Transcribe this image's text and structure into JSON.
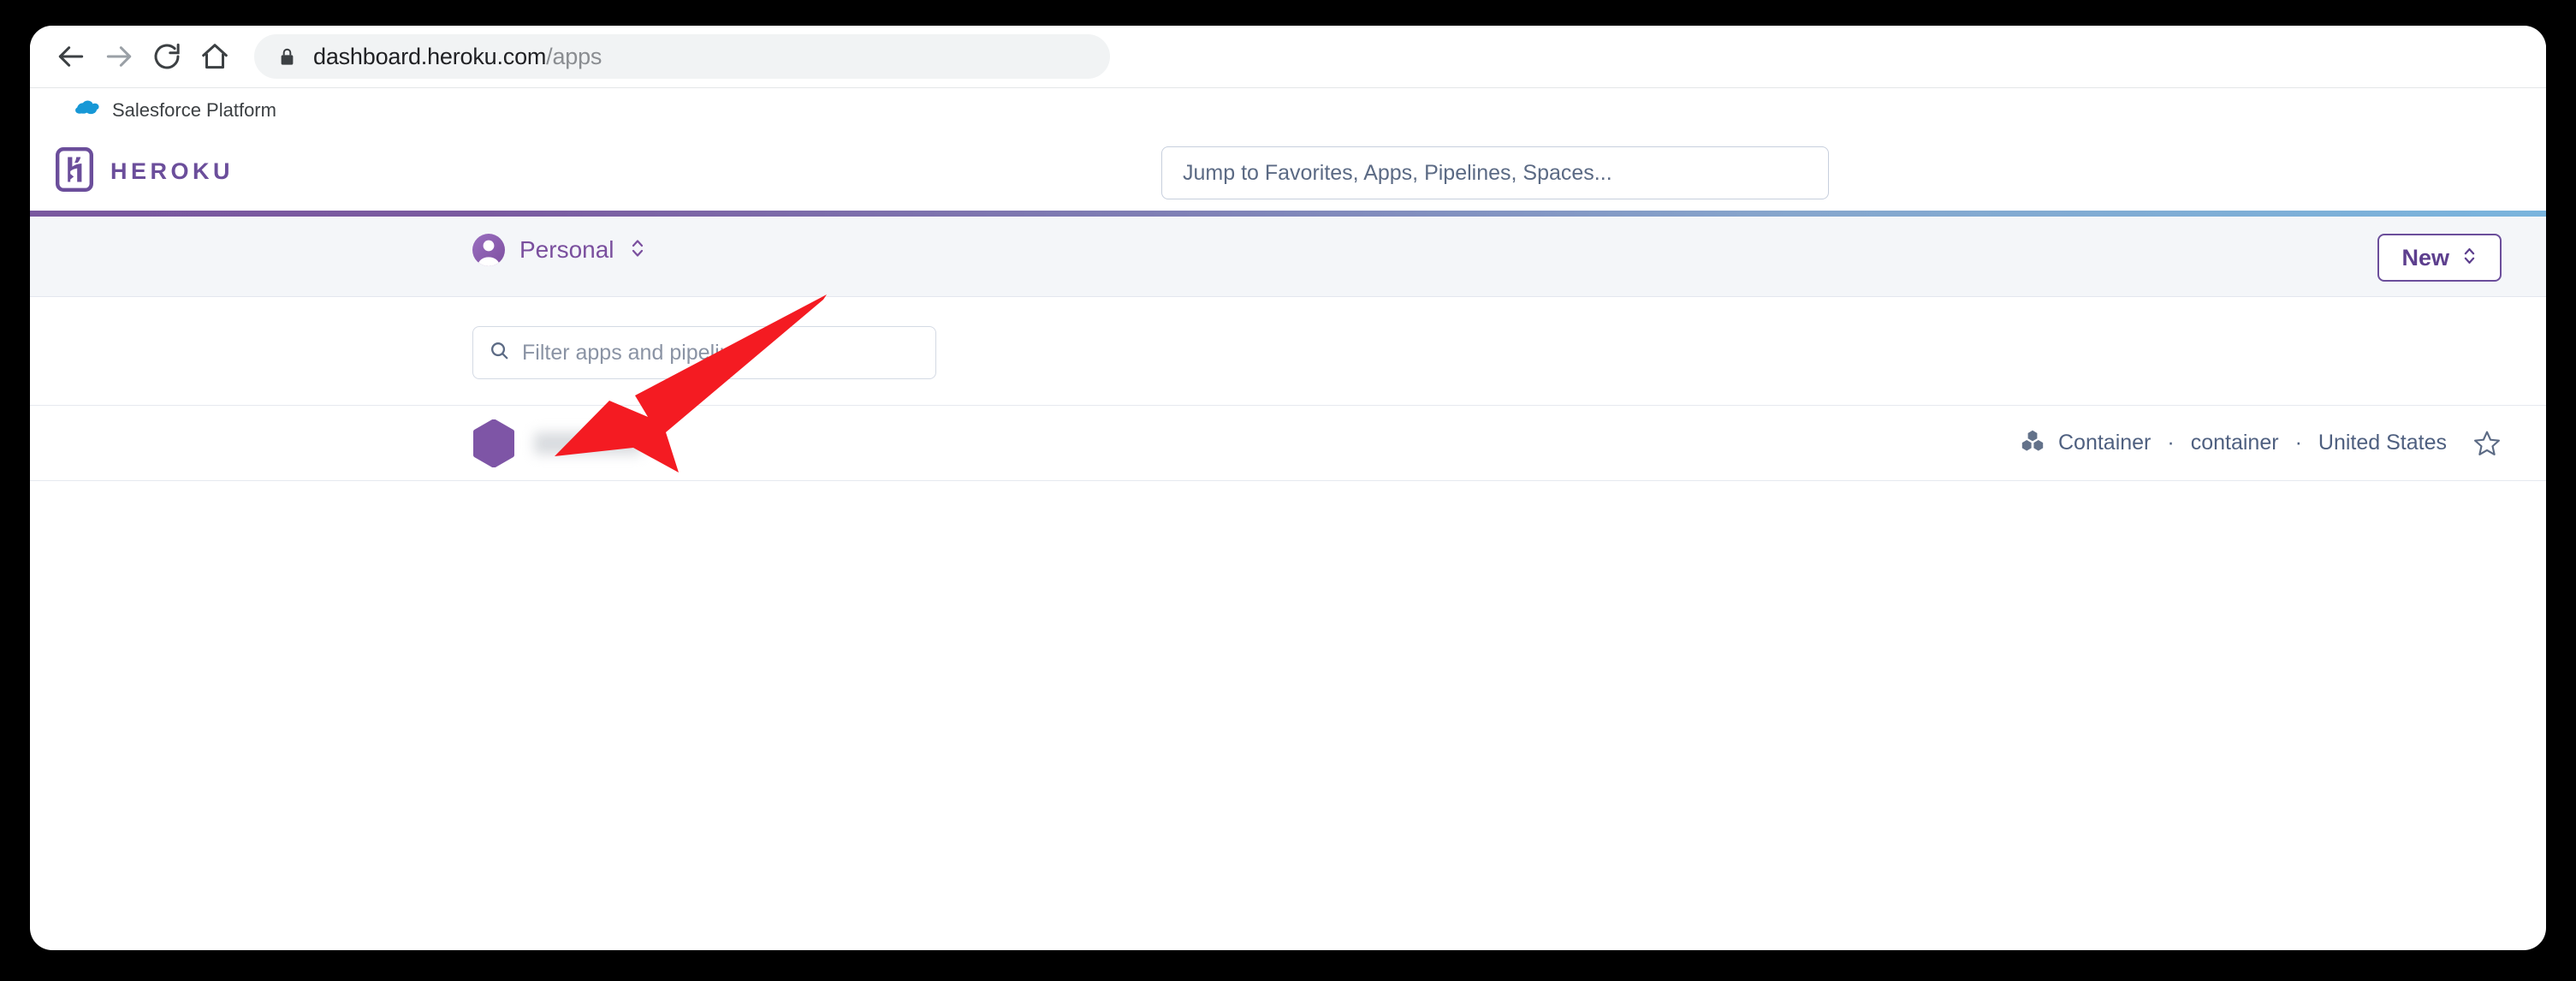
{
  "browser": {
    "nav": {
      "back_icon": "arrow-left-icon",
      "forward_icon": "arrow-right-icon",
      "reload_icon": "reload-icon",
      "home_icon": "home-icon"
    },
    "omnibox": {
      "lock_icon": "lock-icon",
      "url_host": "dashboard.heroku.com",
      "url_path": "/apps"
    },
    "bookmarks": [
      {
        "label": "Salesforce Platform",
        "icon": "salesforce-cloud-icon"
      }
    ]
  },
  "heroku_header": {
    "logo_icon": "heroku-logo-icon",
    "wordmark": "HEROKU",
    "search": {
      "placeholder": "Jump to Favorites, Apps, Pipelines, Spaces...",
      "value": ""
    },
    "gradient": {
      "from": "#79589f",
      "to": "#79b4dd"
    }
  },
  "account_bar": {
    "avatar_icon": "user-avatar-icon",
    "account_name": "Personal",
    "chevron_icon": "chevron-up-down-icon",
    "new_button": {
      "label": "New",
      "chevron_icon": "chevron-up-down-icon"
    }
  },
  "apps": {
    "filter": {
      "icon": "search-icon",
      "placeholder": "Filter apps and pipelines",
      "value": ""
    },
    "rows": [
      {
        "app_icon": "hexagon-app-icon",
        "app_name": "",
        "app_name_redacted": true,
        "stack_icon": "container-cubes-icon",
        "stack": "Container",
        "type": "container",
        "region": "United States",
        "separator": "·",
        "favorite_icon": "star-outline-icon"
      }
    ]
  },
  "annotation": {
    "arrow_color": "#F41B22",
    "arrow_tip": "648,533",
    "arrow_tail": "966,344"
  },
  "colors": {
    "heroku_purple": "#6b4e9b",
    "account_purple": "#7a4f9e",
    "meta_text": "#4f6080",
    "bar_bg": "#f4f6f9",
    "accent_red": "#F41B22"
  }
}
